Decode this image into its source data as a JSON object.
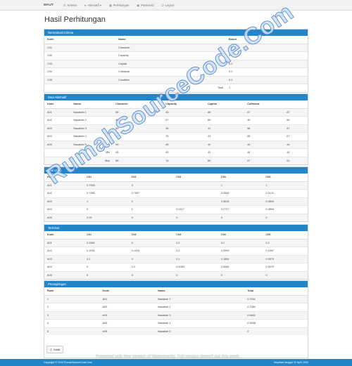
{
  "navbar": {
    "brand": "MAUT",
    "items": [
      {
        "label": "Kriteria",
        "icon": "list-icon"
      },
      {
        "label": "Alternatif ▾",
        "icon": "user-icon"
      },
      {
        "label": "Perhitungan",
        "icon": "calculator-icon"
      },
      {
        "label": "Password",
        "icon": "lock-icon"
      },
      {
        "label": "Logout",
        "icon": "logout-icon"
      }
    ]
  },
  "page_title": "Hasil Perhitungan",
  "normalisasi": {
    "title": "Normalisasi Kriteria",
    "headers": [
      "Kode",
      "Nama",
      "Bobot"
    ],
    "rows": [
      [
        "C01",
        "Character",
        "0.2"
      ],
      [
        "C02",
        "Capacity",
        "0.2"
      ],
      [
        "C03",
        "Capital",
        "0.2"
      ],
      [
        "C04",
        "Collateral",
        "0.2"
      ],
      [
        "C05",
        "Condition",
        "0.2"
      ]
    ],
    "total_label": "Total",
    "total_value": "1"
  },
  "alternatif": {
    "title": "Data Alternatif",
    "headers": [
      "Kode",
      "Nama",
      "Character",
      "Capacity",
      "Capital",
      "Collateral",
      ""
    ],
    "rows": [
      [
        "A01",
        "Nasabah 1",
        "85",
        "45",
        "88",
        "67",
        "87"
      ],
      [
        "A02",
        "Nasabah 2",
        "85",
        "67",
        "89",
        "45",
        "56"
      ],
      [
        "A03",
        "Nasabah 3",
        "85",
        "45",
        "41",
        "56",
        "87"
      ],
      [
        "A04",
        "Nasabah 4",
        "45",
        "76",
        "41",
        "65",
        "67"
      ],
      [
        "A05",
        "Nasabah 5",
        "56",
        "45",
        "42",
        "44",
        "44"
      ],
      [
        "",
        "Min",
        "45",
        "45",
        "41",
        "44",
        "44"
      ],
      [
        "",
        "Max",
        "85",
        "76",
        "89",
        "67",
        "91"
      ]
    ]
  },
  "utility": {
    "title": "Nilai Utility",
    "headers": [
      "Kode",
      "C01",
      "C02",
      "C03",
      "C04",
      "C05"
    ],
    "rows": [
      [
        "A01",
        "0.7955",
        "0",
        "",
        "1",
        "1"
      ],
      [
        "A02",
        "0.7955",
        "0.7097",
        "",
        "0.4546",
        "0.1124"
      ],
      [
        "A03",
        "1",
        "0",
        "",
        "0.5618",
        "0.4894"
      ],
      [
        "A04",
        "0",
        "1",
        "0.0417",
        "0.2727",
        "0.4894"
      ],
      [
        "A05",
        "0.25",
        "0",
        "0",
        "0",
        "0"
      ]
    ]
  },
  "terbobot": {
    "title": "Terbobot",
    "headers": [
      "Kode",
      "C01",
      "C02",
      "C03",
      "C04",
      "C05"
    ],
    "rows": [
      [
        "A01",
        "0.1591",
        "0",
        "0.2",
        "0.2",
        "0.2"
      ],
      [
        "A02",
        "0.1591",
        "0.1419",
        "0.2",
        "0.0909",
        "0.1957"
      ],
      [
        "A03",
        "0.2",
        "0",
        "0.1",
        "0.1864",
        "0.0979"
      ],
      [
        "A04",
        "0",
        "0.2",
        "0.0083",
        "0.0545",
        "0.0979"
      ],
      [
        "A05",
        "0",
        "0",
        "0",
        "0",
        "0"
      ]
    ]
  },
  "perangkingan": {
    "title": "Perangkingan",
    "headers": [
      "Rank",
      "Kode",
      "Nama",
      "Total"
    ],
    "rows": [
      [
        "1",
        "A01",
        "Nasabah 1",
        "0.7591"
      ],
      [
        "2",
        "A02",
        "Nasabah 2",
        "0.7380"
      ],
      [
        "3",
        "A03",
        "Nasabah 3",
        "0.5842"
      ],
      [
        "4",
        "A04",
        "Nasabah 4",
        "0.3608"
      ],
      [
        "5",
        "A05",
        "Nasabah 5",
        "0"
      ]
    ]
  },
  "print_button": "Cetak",
  "footer": {
    "left": "Copyright © 2020 RumahSourceCode.Com",
    "right": "Diupdate tanggal 22 April 2020"
  },
  "watermark_notice": "Protected with free version of Watermarkly. Full version doesn't put this mark.",
  "watermark": "RumahSourceCode.Com"
}
